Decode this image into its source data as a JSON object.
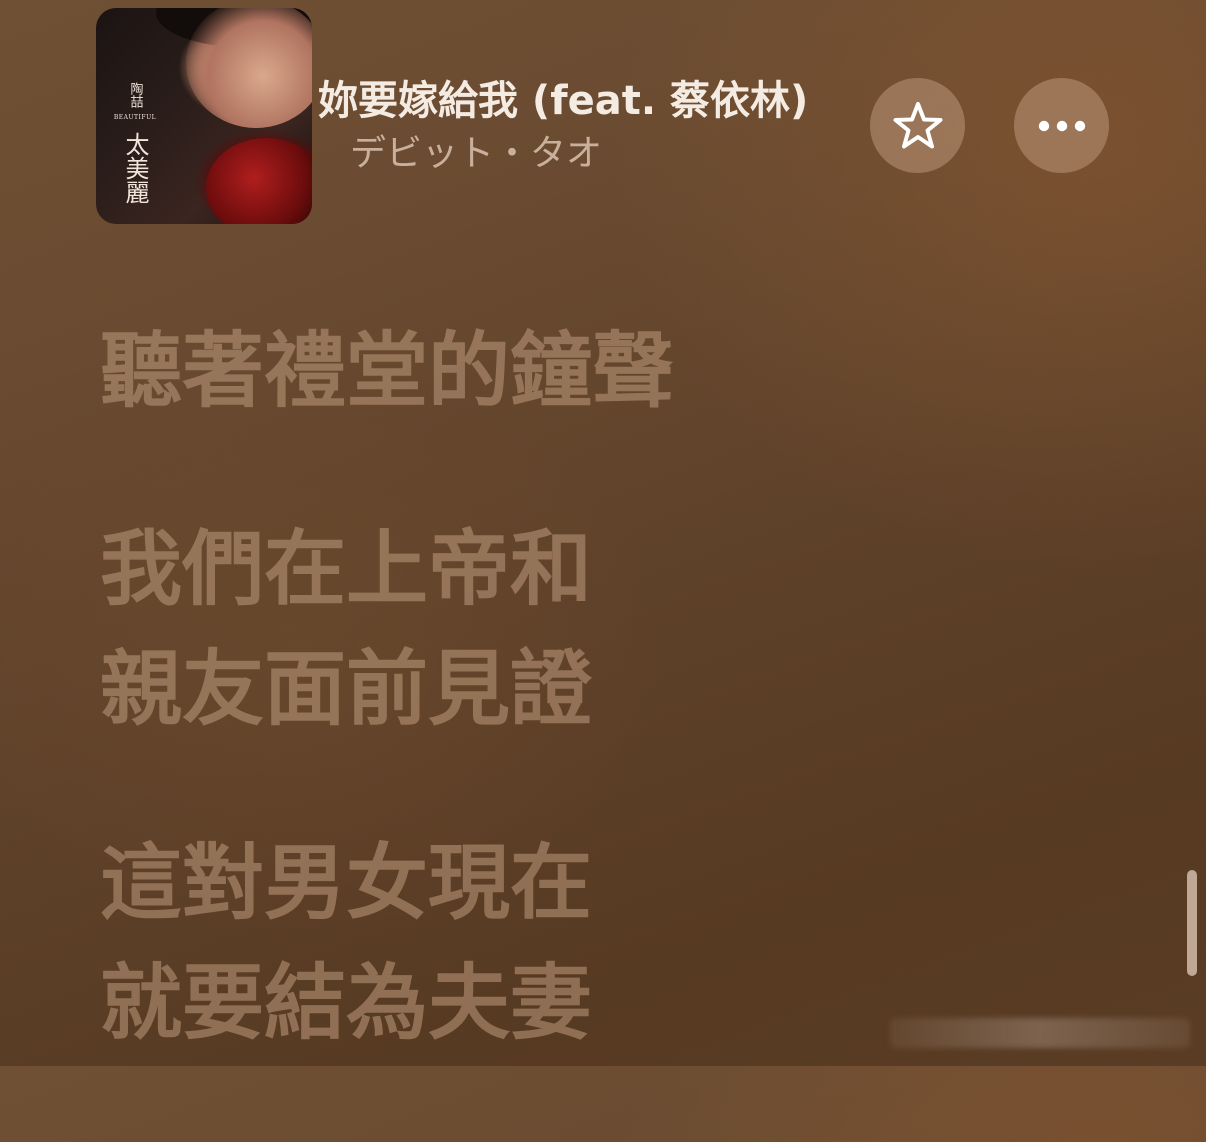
{
  "now_playing": {
    "album_art": {
      "artist_text": "陶喆",
      "subtitle_text": "BEAUTIFUL",
      "title_text": "太美麗"
    },
    "title": "妳要嫁給我 (feat. 蔡依林)",
    "artist": "デビット・タオ",
    "favorite_icon": "star-outline-icon",
    "more_icon": "ellipsis-icon"
  },
  "lyrics": {
    "lines": [
      [
        "聽著禮堂的鐘聲"
      ],
      [
        "我們在上帝和",
        "親友面前見證"
      ],
      [
        "這對男女現在",
        "就要結為夫妻"
      ]
    ]
  },
  "colors": {
    "background": "#5e4129",
    "title_text": "#f4ebe3",
    "lyric_text": "#b89678"
  }
}
